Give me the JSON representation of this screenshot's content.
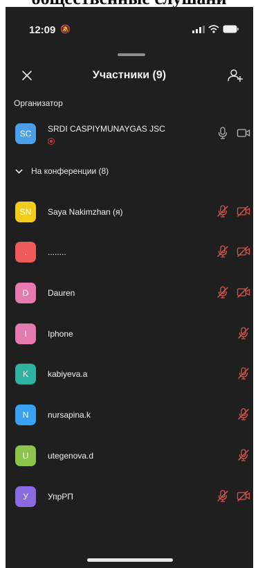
{
  "caption": "общественные слушани",
  "status_bar": {
    "time": "12:09"
  },
  "header": {
    "title": "Участники (9)"
  },
  "organizer_section": "Организатор",
  "organizer": {
    "initials": "SC",
    "name": "SRDI CASPIYMUNAYGAS JSC",
    "color": "#4a9fe8"
  },
  "conference_group": {
    "label": "На конференции (8)"
  },
  "participants": [
    {
      "initials": "SN",
      "name": "Saya Nakimzhan (я)",
      "color": "#f2cc1b"
    },
    {
      "initials": ".",
      "name": "........",
      "color": "#ee5a5a"
    },
    {
      "initials": "D",
      "name": "Dauren",
      "color": "#e57ab0"
    },
    {
      "initials": "I",
      "name": "Iphone",
      "color": "#e57ab0"
    },
    {
      "initials": "K",
      "name": "kabiyeva.a",
      "color": "#2fb2a0"
    },
    {
      "initials": "N",
      "name": "nursapina.k",
      "color": "#3aa0f0"
    },
    {
      "initials": "U",
      "name": "utegenova.d",
      "color": "#8cc44c"
    },
    {
      "initials": "У",
      "name": "УпрРП",
      "color": "#8a6ae0"
    }
  ],
  "colors": {
    "muted_red": "#d9534f",
    "icon_gray": "#b5b5b5",
    "background": "#1f1f1f"
  },
  "icons": [
    "close-icon",
    "add-user-icon",
    "microphone-icon",
    "microphone-muted-icon",
    "camera-icon",
    "camera-off-icon",
    "chevron-down-icon",
    "recording-icon"
  ]
}
